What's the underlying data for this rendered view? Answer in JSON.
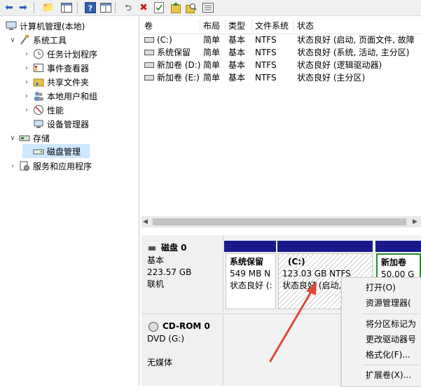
{
  "toolbar": {
    "buttons": [
      "back-icon",
      "forward-icon",
      "up-folder-icon",
      "show-hide-tree-icon",
      "help-icon",
      "properties-icon",
      "connect-icon",
      "delete-icon",
      "checklist-icon",
      "export-icon",
      "search-icon",
      "list-icon"
    ]
  },
  "tree": {
    "root": "计算机管理(本地)",
    "system_tools": "系统工具",
    "task_scheduler": "任务计划程序",
    "event_viewer": "事件查看器",
    "shared_folders": "共享文件夹",
    "local_users": "本地用户和组",
    "performance": "性能",
    "device_manager": "设备管理器",
    "storage": "存储",
    "disk_management": "磁盘管理",
    "services_apps": "服务和应用程序"
  },
  "volume_list": {
    "headers": {
      "volume": "卷",
      "layout": "布局",
      "type": "类型",
      "fs": "文件系统",
      "status": "状态"
    },
    "rows": [
      {
        "volume": "(C:)",
        "layout": "简单",
        "type": "基本",
        "fs": "NTFS",
        "status": "状态良好 (启动, 页面文件, 故障"
      },
      {
        "volume": "系统保留",
        "layout": "简单",
        "type": "基本",
        "fs": "NTFS",
        "status": "状态良好 (系统, 活动, 主分区)"
      },
      {
        "volume": "新加卷 (D:)",
        "layout": "简单",
        "type": "基本",
        "fs": "NTFS",
        "status": "状态良好 (逻辑驱动器)"
      },
      {
        "volume": "新加卷 (E:)",
        "layout": "简单",
        "type": "基本",
        "fs": "NTFS",
        "status": "状态良好 (主分区)"
      }
    ]
  },
  "disk0": {
    "title": "磁盘 0",
    "type": "基本",
    "size": "223.57 GB",
    "status": "联机",
    "partitions": [
      {
        "name": "系统保留",
        "size": "549 MB N",
        "status": "状态良好 (:"
      },
      {
        "name": "(C:)",
        "size": "123.03 GB NTFS",
        "status": "状态良好 (启动,"
      },
      {
        "name": "新加卷",
        "size": "50.00 G",
        "status": ""
      }
    ]
  },
  "cdrom0": {
    "title": "CD-ROM 0",
    "type": "DVD (G:)",
    "status": "无媒体"
  },
  "context_menu": {
    "open": "打开(O)",
    "explorer": "资源管理器(",
    "mark_active": "将分区标记为",
    "change_letter": "更改驱动器号",
    "format": "格式化(F)...",
    "extend": "扩展卷(X)..."
  },
  "colors": {
    "partition_bar": "#1a1a8c",
    "logical_bar": "#2e8b2e",
    "selection": "#cde8ff",
    "arrow": "#e0483a"
  }
}
